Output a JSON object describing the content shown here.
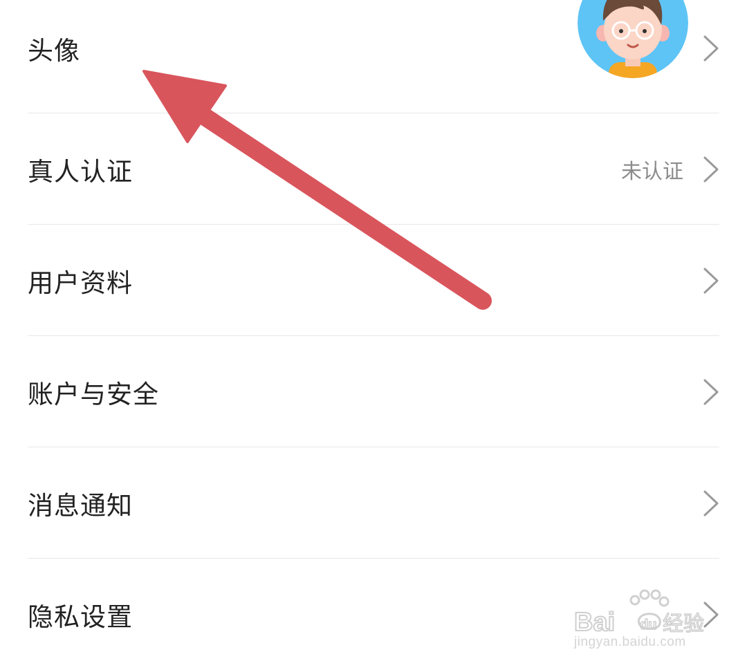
{
  "rows": [
    {
      "label": "头像",
      "value": "",
      "has_avatar": true
    },
    {
      "label": "真人认证",
      "value": "未认证"
    },
    {
      "label": "用户资料",
      "value": ""
    },
    {
      "label": "账户与安全",
      "value": ""
    },
    {
      "label": "消息通知",
      "value": ""
    },
    {
      "label": "隐私设置",
      "value": ""
    }
  ],
  "annotation": {
    "arrow_color": "#d9555c"
  },
  "colors": {
    "avatar_bg": "#5ec4f6",
    "text": "#222222",
    "secondary": "#8c8c8c"
  },
  "watermark": {
    "brand": "Baidu 经验",
    "url": "jingyan.baidu.com"
  }
}
